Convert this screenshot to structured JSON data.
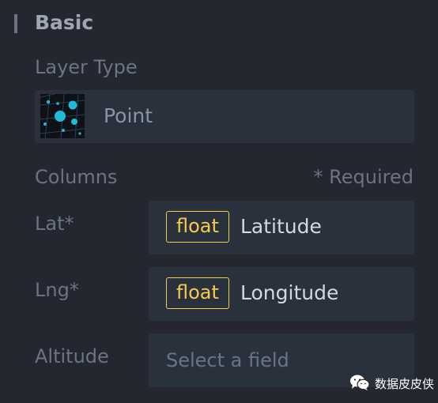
{
  "section": {
    "title": "Basic"
  },
  "layer_type": {
    "label": "Layer Type",
    "selected": "Point",
    "thumbnail_icon": "point-map-icon"
  },
  "columns": {
    "label": "Columns",
    "required_note": "* Required",
    "fields": [
      {
        "label": "Lat*",
        "type": "float",
        "value": "Latitude"
      },
      {
        "label": "Lng*",
        "type": "float",
        "value": "Longitude"
      },
      {
        "label": "Altitude",
        "placeholder": "Select a field"
      }
    ]
  },
  "watermark": {
    "icon": "wechat-icon",
    "text": "数据皮皮侠"
  },
  "colors": {
    "background": "#242730",
    "input_background": "#29323c",
    "label": "#6a7485",
    "value": "#d3d8e0",
    "type_tag": "#f7c94e"
  }
}
